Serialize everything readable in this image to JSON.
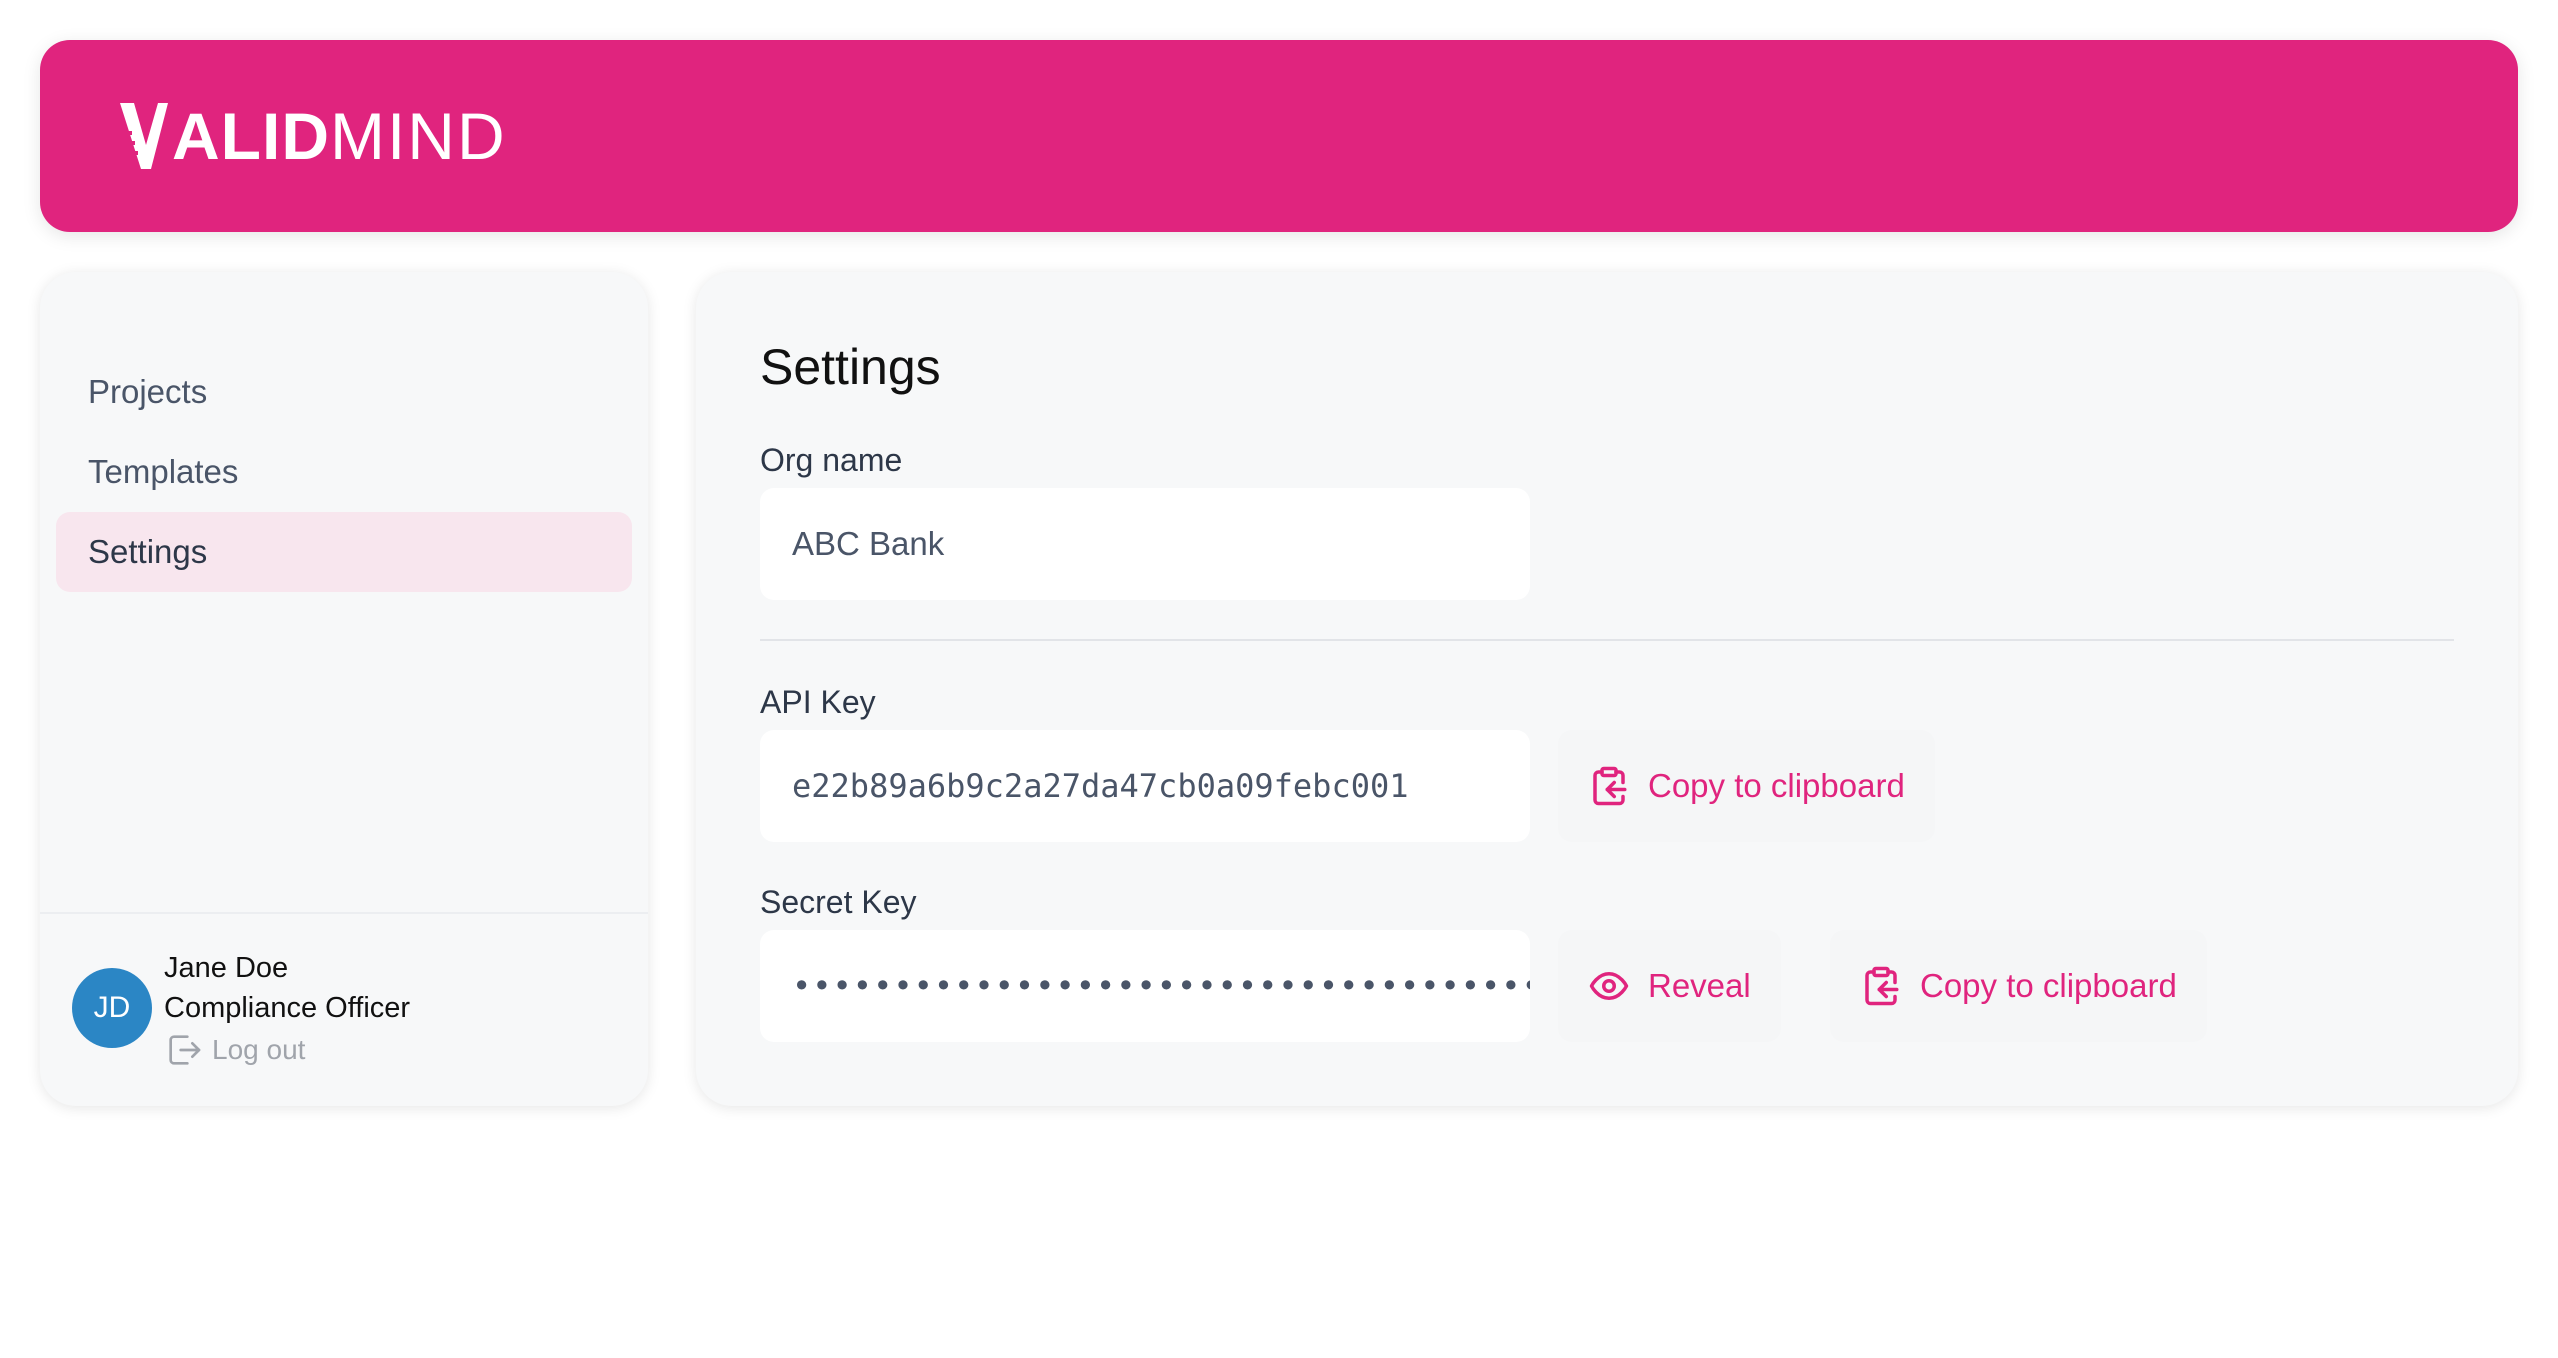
{
  "brand": {
    "name_bold": "ALID",
    "name_light": "MIND",
    "color": "#e0247e"
  },
  "sidebar": {
    "items": [
      {
        "label": "Projects",
        "active": false
      },
      {
        "label": "Templates",
        "active": false
      },
      {
        "label": "Settings",
        "active": true
      }
    ],
    "user": {
      "initials": "JD",
      "name": "Jane Doe",
      "role": "Compliance Officer",
      "logout_label": "Log out",
      "avatar_color": "#2b86c5"
    }
  },
  "main": {
    "title": "Settings",
    "org": {
      "label": "Org name",
      "value": "ABC Bank"
    },
    "api_key": {
      "label": "API Key",
      "value": "e22b89a6b9c2a27da47cb0a09febc001",
      "copy_label": "Copy to clipboard"
    },
    "secret_key": {
      "label": "Secret Key",
      "value": "••••••••••••••••••••••••••••••••••••••••",
      "reveal_label": "Reveal",
      "copy_label": "Copy to clipboard"
    }
  },
  "icons": {
    "copy": "clipboard-copy-icon",
    "reveal": "eye-icon",
    "logout": "logout-icon"
  }
}
